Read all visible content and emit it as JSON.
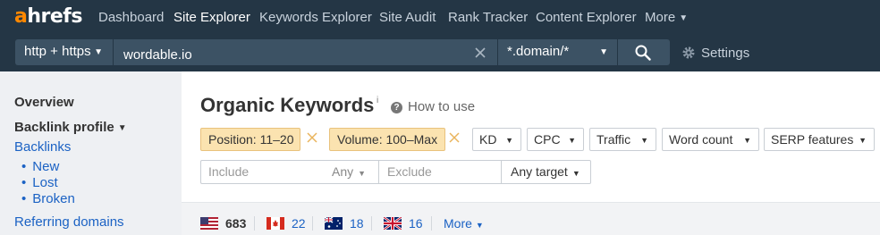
{
  "brand": {
    "logo_first": "a",
    "logo_rest": "hrefs",
    "accent": "#ff8800"
  },
  "nav": {
    "items": [
      {
        "label": "Dashboard",
        "active": false
      },
      {
        "label": "Site Explorer",
        "active": true
      },
      {
        "label": "Keywords Explorer",
        "active": false
      },
      {
        "label": "Site Audit",
        "active": false
      },
      {
        "label": "Rank Tracker",
        "active": false
      },
      {
        "label": "Content Explorer",
        "active": false
      }
    ],
    "more": "More"
  },
  "search": {
    "protocol": "http + https",
    "target": "wordable.io",
    "mode": "*.domain/*",
    "settings": "Settings"
  },
  "sidebar": {
    "overview": "Overview",
    "backlink_profile": "Backlink profile",
    "backlinks": "Backlinks",
    "sub_items": [
      "New",
      "Lost",
      "Broken"
    ],
    "referring_domains": "Referring domains"
  },
  "main": {
    "title": "Organic Keywords",
    "info": "i",
    "how_to_use": "How to use",
    "active_filters": [
      "Position: 11–20",
      "Volume: 100–Max"
    ],
    "filter_dropdowns": [
      "KD",
      "CPC",
      "Traffic",
      "Word count",
      "SERP features"
    ],
    "include_placeholder": "Include",
    "any": "Any",
    "exclude_placeholder": "Exclude",
    "any_target": "Any target"
  },
  "countries": [
    {
      "flag": "us-flag-icon",
      "count": "683"
    },
    {
      "flag": "canada-flag-icon",
      "count": "22"
    },
    {
      "flag": "australia-flag-icon",
      "count": "18"
    },
    {
      "flag": "uk-flag-icon",
      "count": "16"
    }
  ],
  "countries_more": "More",
  "colors": {
    "nav_bg": "#243645",
    "input_bg": "#3c5264",
    "chip_bg": "#fbe3b0",
    "link": "#1b62c4",
    "sidebar_bg": "#eef0f3"
  }
}
